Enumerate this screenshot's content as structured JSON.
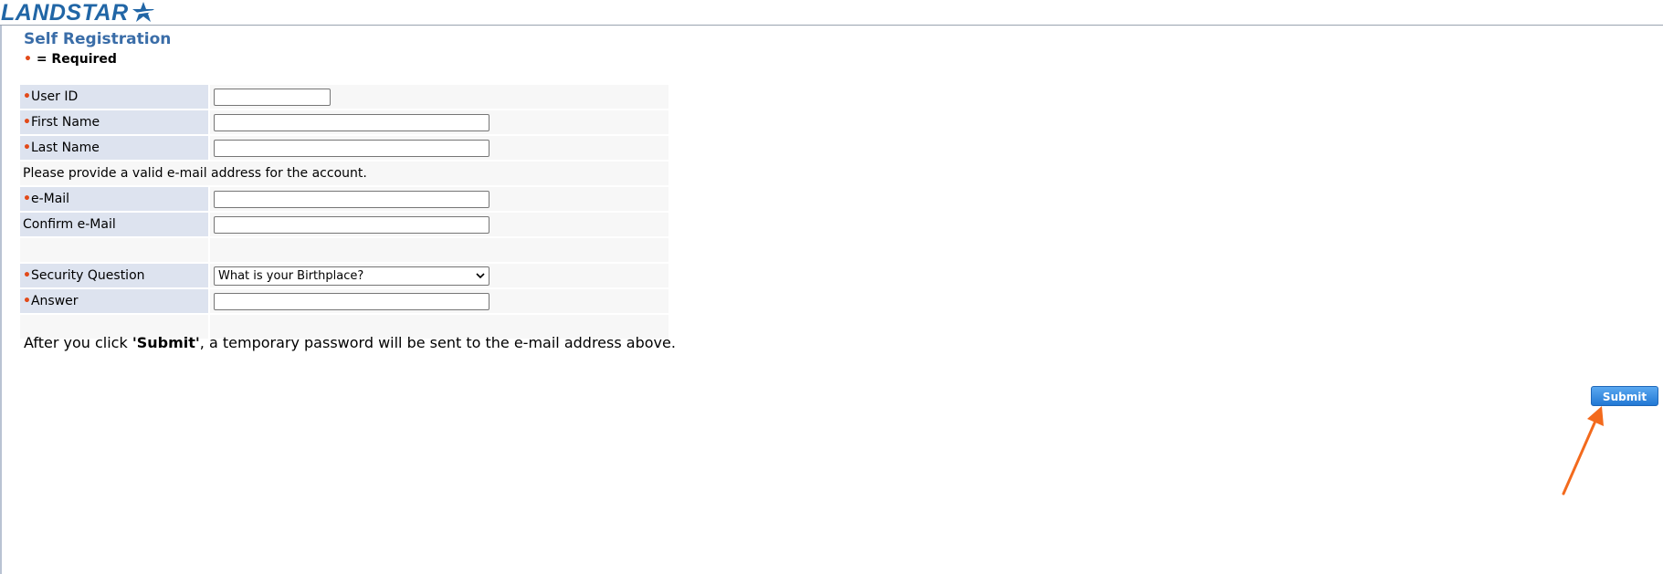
{
  "brand": {
    "name": "LANDSTAR",
    "color": "#2166a6"
  },
  "page": {
    "title": "Self Registration",
    "required_marker": "•",
    "required_text": "= Required"
  },
  "form": {
    "user_id": {
      "label": "User ID",
      "value": ""
    },
    "first_name": {
      "label": "First Name",
      "value": ""
    },
    "last_name": {
      "label": "Last Name",
      "value": ""
    },
    "email_note": "Please provide a valid e-mail address for the account.",
    "email": {
      "label": "e-Mail",
      "value": ""
    },
    "confirm_email": {
      "label": "Confirm e-Mail",
      "value": ""
    },
    "security_question": {
      "label": "Security Question",
      "selected": "What is your Birthplace?"
    },
    "answer": {
      "label": "Answer",
      "value": ""
    }
  },
  "footer_note": {
    "prefix": "After you click ",
    "bold": "'Submit'",
    "suffix": ", a temporary password will be sent to the e-mail address above."
  },
  "submit": {
    "label": "Submit"
  },
  "colors": {
    "accent": "#3a6da8",
    "required_dot": "#e24a1a",
    "label_bg": "#dde3ef",
    "button": "#2278d4",
    "annotation_arrow": "#f36a1d"
  },
  "icons": {
    "logo_star": "star-icon",
    "select_chevron": "chevron-down-icon",
    "annotation": "arrow-icon"
  }
}
